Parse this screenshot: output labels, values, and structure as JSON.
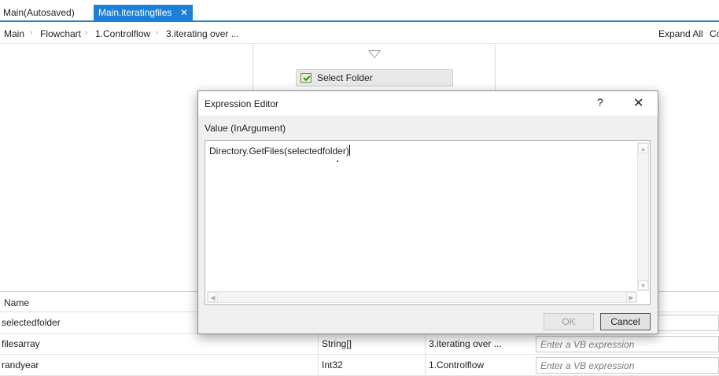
{
  "tabs": [
    {
      "label": "Main(Autosaved)",
      "active": false
    },
    {
      "label": "Main.iteratingfiles",
      "active": true,
      "close": "✕"
    }
  ],
  "breadcrumb": {
    "items": [
      "Main",
      "Flowchart",
      "1.Controlflow",
      "3.iterating over ..."
    ],
    "separator": "›",
    "expand_all": "Expand All",
    "collapse_partial": "Co"
  },
  "canvas": {
    "activity_label": "Select Folder",
    "activity_icon": "folder-select-icon"
  },
  "variables": {
    "header_name": "Name",
    "rows": [
      {
        "name": "selectedfolder",
        "type": "",
        "scope": "",
        "default": ""
      },
      {
        "name": "filesarray",
        "type": "String[]",
        "scope": "3.iterating over ...",
        "default": "Enter a VB expression"
      },
      {
        "name": "randyear",
        "type": "Int32",
        "scope": "1.Controlflow",
        "default": "Enter a VB expression"
      }
    ]
  },
  "dialog": {
    "title": "Expression Editor",
    "help": "?",
    "close": "✕",
    "value_label": "Value (InArgument)",
    "expression": "Directory.GetFiles(selectedfolder)",
    "ok_label": "OK",
    "cancel_label": "Cancel"
  },
  "colors": {
    "accent": "#1c80d6",
    "dialog_bg": "#f0f0f0"
  }
}
